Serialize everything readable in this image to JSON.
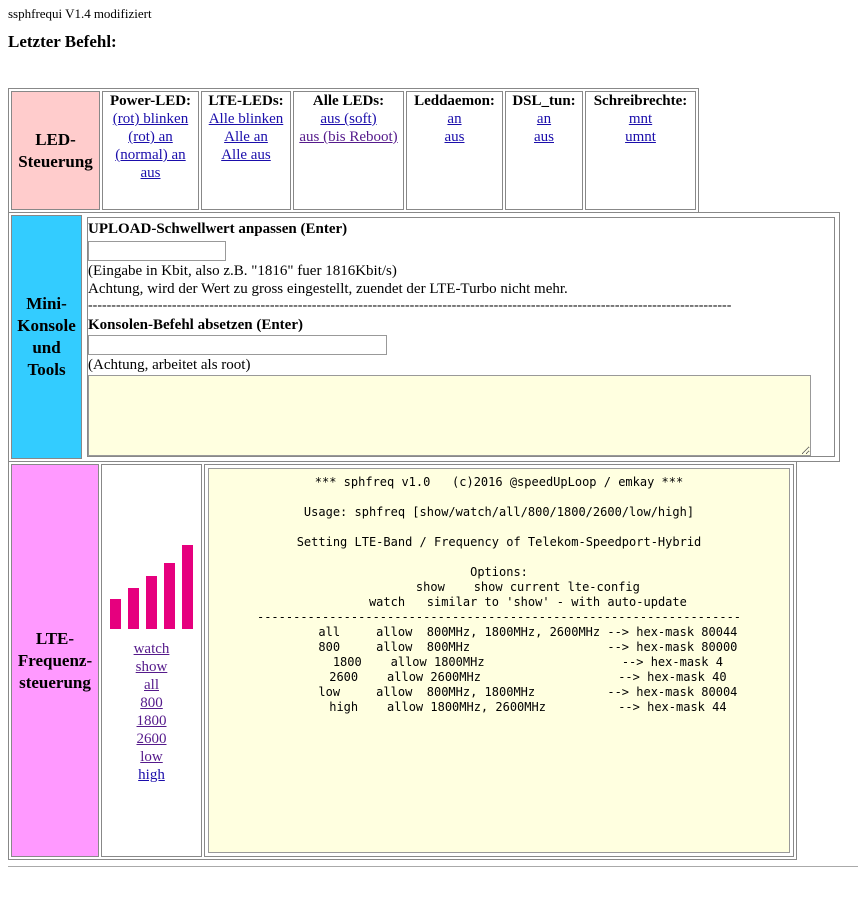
{
  "header": {
    "app_name": "ssphfrequi",
    "version": "V1.4",
    "status": "modifiziert",
    "last_command_label": "Letzter Befehl:"
  },
  "led": {
    "section_label": "LED-\nSteuerung",
    "power": {
      "title": "Power-LED:",
      "links": [
        "(rot) blinken",
        "(rot) an",
        "(normal) an",
        "aus"
      ]
    },
    "lte": {
      "title": "LTE-LEDs:",
      "links": [
        "Alle blinken",
        "Alle an",
        "Alle aus"
      ]
    },
    "all": {
      "title": "Alle LEDs:",
      "links": [
        "aus (soft)",
        "aus (bis Reboot)"
      ]
    },
    "leddaemon": {
      "title": "Leddaemon:",
      "links": [
        "an",
        "aus"
      ]
    },
    "dsl": {
      "title": "DSL_tun:",
      "links": [
        "an",
        "aus"
      ]
    },
    "write": {
      "title": "Schreibrechte:",
      "links": [
        "mnt",
        "umnt"
      ]
    }
  },
  "mini": {
    "section_label": "Mini-\nKonsole\nund\nTools",
    "upload_label": "UPLOAD-Schwellwert anpassen (Enter)",
    "upload_value": "",
    "upload_hint": "(Eingabe in Kbit, also z.B. \"1816\" fuer 1816Kbit/s)",
    "upload_warning": "Achtung, wird der Wert zu gross eingestellt, zuendet der LTE-Turbo nicht mehr.",
    "separator": "------------------------------------------------------------------------------------------------------------------------------------------",
    "console_label": "Konsolen-Befehl absetzen (Enter)",
    "console_value": "",
    "console_hint": "(Achtung, arbeitet als root)",
    "console_output": ""
  },
  "lte": {
    "section_label": "LTE-\nFrequenz-\nsteuerung",
    "bar_color": "#e6007e",
    "links": [
      "watch",
      "show",
      "all",
      "800",
      "1800",
      "2600",
      "low",
      "high"
    ],
    "output": "*** sphfreq v1.0   (c)2016 @speedUpLoop / emkay ***\n\nUsage: sphfreq [show/watch/all/800/1800/2600/low/high]\n\nSetting LTE-Band / Frequency of Telekom-Speedport-Hybrid\n\nOptions:\n        show    show current lte-config\n        watch   similar to 'show' - with auto-update\n-------------------------------------------------------------------\n        all     allow  800MHz, 1800MHz, 2600MHz --> hex-mask 80044\n        800     allow  800MHz                   --> hex-mask 80000\n        1800    allow 1800MHz                   --> hex-mask 4\n        2600    allow 2600MHz                   --> hex-mask 40\n        low     allow  800MHz, 1800MHz          --> hex-mask 80004\n        high    allow 1800MHz, 2600MHz          --> hex-mask 44"
  }
}
